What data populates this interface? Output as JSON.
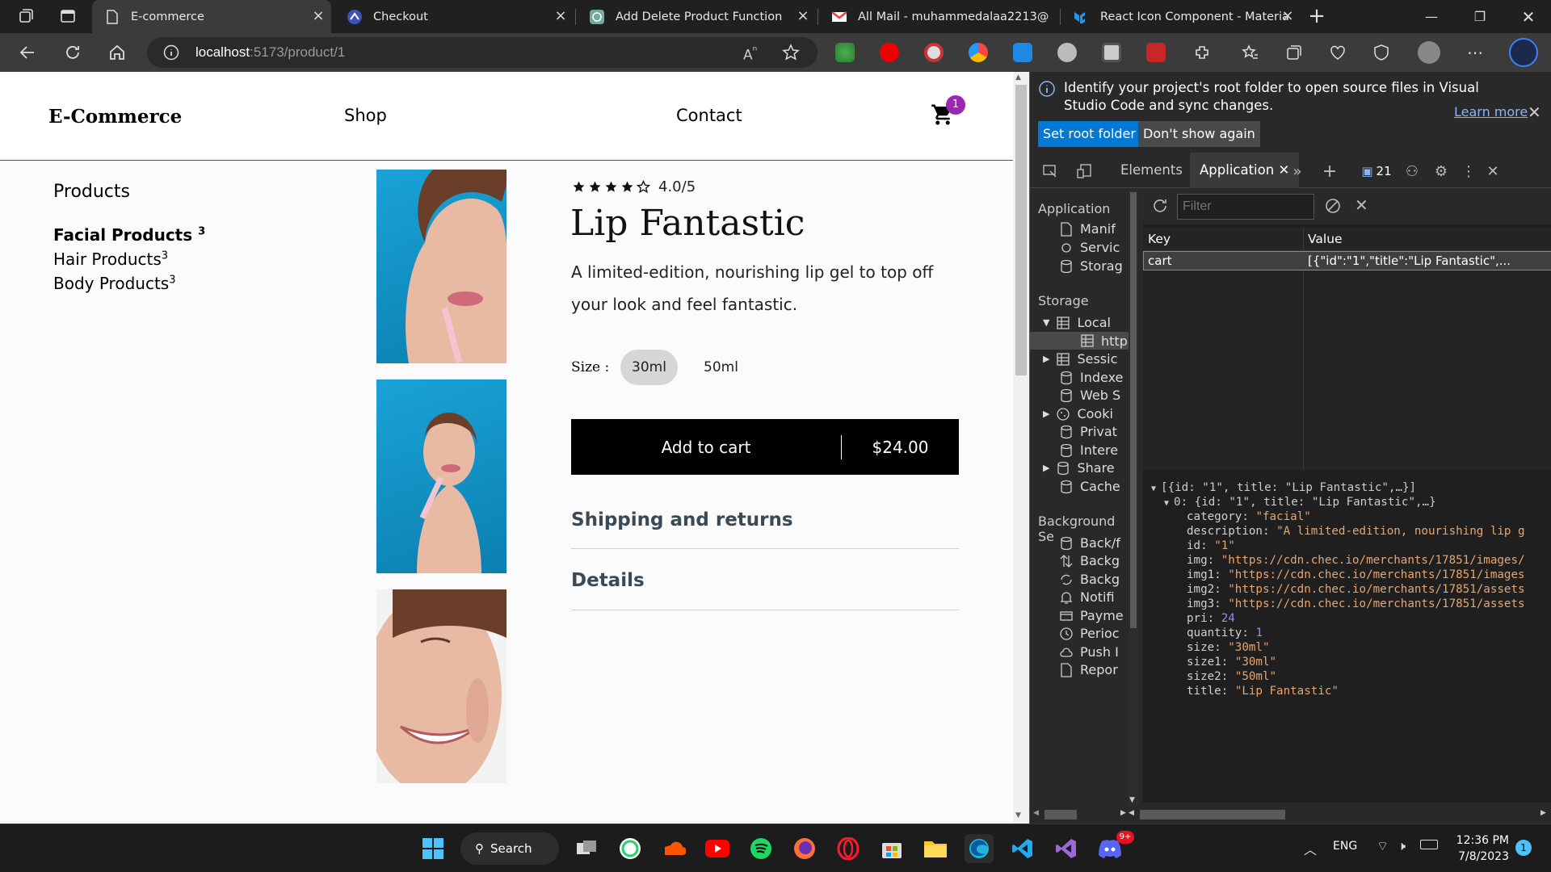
{
  "browser": {
    "tabs": [
      {
        "title": "E-commerce",
        "active": true
      },
      {
        "title": "Checkout"
      },
      {
        "title": "Add Delete Product Function"
      },
      {
        "title": "All Mail - muhammedalaa2213@"
      },
      {
        "title": "React Icon Component - Materia"
      }
    ],
    "new_tab": "+",
    "url_host": "localhost",
    "url_path": ":5173/product/1",
    "window_controls": [
      "minimize-icon",
      "restore-icon",
      "close-icon"
    ]
  },
  "site": {
    "brand": "E-Commerce",
    "nav": {
      "shop": "Shop",
      "contact": "Contact"
    },
    "cart_count": "1",
    "sidebar": {
      "heading": "Products",
      "categories": [
        {
          "label": "Facial Products",
          "count": "3",
          "active": true
        },
        {
          "label": "Hair Products",
          "count": "3"
        },
        {
          "label": "Body Products",
          "count": "3"
        }
      ]
    },
    "product": {
      "rating_text": "4.0/5",
      "rating": 4,
      "title": "Lip Fantastic",
      "description": "A limited-edition, nourishing lip gel to top off your look and feel fantastic.",
      "size_label": "Size :",
      "sizes": [
        "30ml",
        "50ml"
      ],
      "selected_size": "30ml",
      "add_to_cart": "Add to cart",
      "price": "$24.00",
      "accordions": [
        "Shipping and returns",
        "Details"
      ]
    }
  },
  "devtools": {
    "info": "Identify your project's root folder to open source files in Visual Studio Code and sync changes.",
    "learn_more": "Learn more",
    "set_root": "Set root folder",
    "dont_show": "Don't show again",
    "tabs": {
      "elements": "Elements",
      "application": "Application"
    },
    "issues_count": "21",
    "sidebar": {
      "application_heading": "Application",
      "application_items": [
        "Manif",
        "Servic",
        "Storag"
      ],
      "storage_heading": "Storage",
      "storage_items": [
        "Local",
        "http",
        "Sessic",
        "Indexe",
        "Web S",
        "Cooki",
        "Privat",
        "Intere",
        "Share",
        "Cache"
      ],
      "background_heading": "Background Se",
      "background_items": [
        "Back/f",
        "Backg",
        "Backg",
        "Notifi",
        "Payme",
        "Perioc",
        "Push I",
        "Repor"
      ]
    },
    "filter_placeholder": "Filter",
    "table": {
      "headers": [
        "Key",
        "Value"
      ],
      "rows": [
        {
          "key": "cart",
          "value": "[{\"id\":\"1\",\"title\":\"Lip Fantastic\",..."
        }
      ]
    },
    "json": {
      "root": "[{id: \"1\", title: \"Lip Fantastic\",…}]",
      "item0": "0: {id: \"1\", title: \"Lip Fantastic\",…}",
      "fields": [
        {
          "k": "category",
          "v": "\"facial\"",
          "t": "s"
        },
        {
          "k": "description",
          "v": "\"A limited-edition, nourishing lip g",
          "t": "s"
        },
        {
          "k": "id",
          "v": "\"1\"",
          "t": "s"
        },
        {
          "k": "img",
          "v": "\"https://cdn.chec.io/merchants/17851/images/",
          "t": "s"
        },
        {
          "k": "img1",
          "v": "\"https://cdn.chec.io/merchants/17851/images",
          "t": "s"
        },
        {
          "k": "img2",
          "v": "\"https://cdn.chec.io/merchants/17851/assets",
          "t": "s"
        },
        {
          "k": "img3",
          "v": "\"https://cdn.chec.io/merchants/17851/assets",
          "t": "s"
        },
        {
          "k": "pri",
          "v": "24",
          "t": "n"
        },
        {
          "k": "quantity",
          "v": "1",
          "t": "n"
        },
        {
          "k": "size",
          "v": "\"30ml\"",
          "t": "s"
        },
        {
          "k": "size1",
          "v": "\"30ml\"",
          "t": "s"
        },
        {
          "k": "size2",
          "v": "\"50ml\"",
          "t": "s"
        },
        {
          "k": "title",
          "v": "\"Lip Fantastic\"",
          "t": "s"
        }
      ]
    }
  },
  "taskbar": {
    "search": "Search",
    "lang": "ENG",
    "time": "12:36 PM",
    "date": "7/8/2023",
    "notif_count": "1",
    "discord_badge": "9+"
  },
  "colors": {
    "accent": "#0078d4",
    "badge": "#9c27b0",
    "json_string": "#e6a671",
    "json_number": "#9b8cf0"
  }
}
